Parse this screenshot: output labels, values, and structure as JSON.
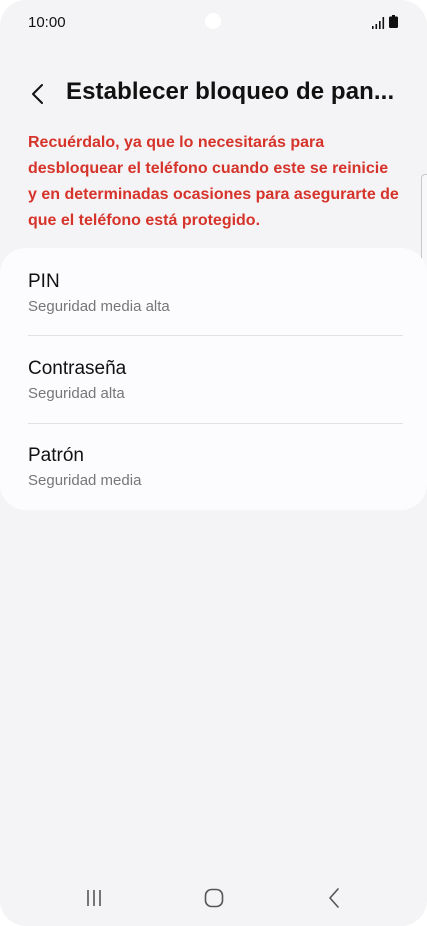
{
  "status_bar": {
    "time": "10:00"
  },
  "header": {
    "title": "Establecer bloqueo de pan..."
  },
  "warning_text": "Recuérdalo, ya que lo necesitarás para desbloquear el teléfono cuando este se reinicie y en determinadas ocasiones para asegurarte de que el teléfono está protegido.",
  "options": [
    {
      "title": "PIN",
      "subtitle": "Seguridad media alta"
    },
    {
      "title": "Contraseña",
      "subtitle": "Seguridad alta"
    },
    {
      "title": "Patrón",
      "subtitle": "Seguridad media"
    }
  ],
  "icons": {
    "back": "back-arrow-icon",
    "signal": "signal-icon",
    "battery": "battery-icon",
    "recents": "recents-icon",
    "home": "home-icon",
    "nav_back": "nav-back-icon"
  },
  "colors": {
    "background": "#f4f4f6",
    "card": "#fcfcfe",
    "warning": "#d6332a",
    "text": "#111111",
    "secondary_text": "#777777"
  }
}
